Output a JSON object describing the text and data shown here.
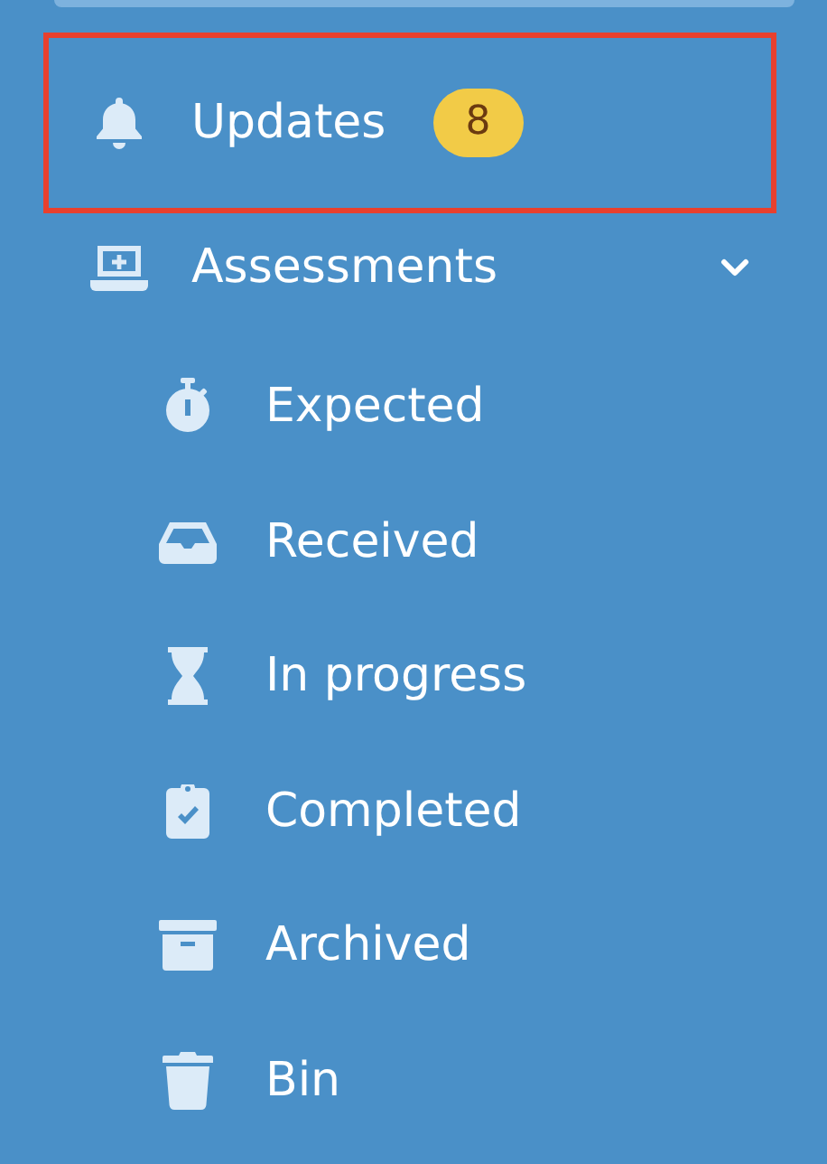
{
  "sidebar": {
    "items": [
      {
        "label": "Updates",
        "badge": "8",
        "highlighted": true
      },
      {
        "label": "Assessments",
        "expanded": true,
        "highlighted": false,
        "children": [
          {
            "label": "Expected"
          },
          {
            "label": "Received"
          },
          {
            "label": "In progress"
          },
          {
            "label": "Completed"
          },
          {
            "label": "Archived"
          },
          {
            "label": "Bin"
          }
        ]
      }
    ]
  }
}
